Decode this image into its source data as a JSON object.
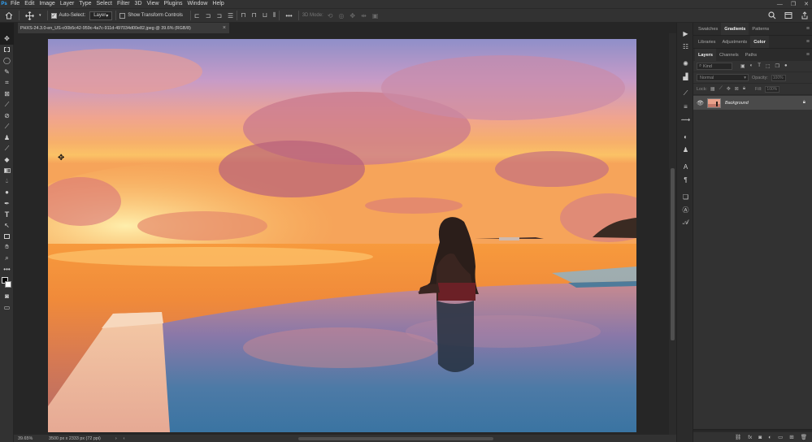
{
  "app": {
    "logo": "Ps",
    "menu": [
      "File",
      "Edit",
      "Image",
      "Layer",
      "Type",
      "Select",
      "Filter",
      "3D",
      "View",
      "Plugins",
      "Window",
      "Help"
    ],
    "window_controls": [
      "—",
      "❐",
      "✕"
    ]
  },
  "options_bar": {
    "auto_select_label": "Auto-Select:",
    "auto_select_checked": true,
    "target_value": "Layer",
    "show_transform_label": "Show Transform Controls",
    "more_label": "•••",
    "mode_3d_label": "3D Mode:"
  },
  "document": {
    "tab_title": "PHXS-24.3.0-en_US-c00b5c42-959c-4a7c-911d-497034d00e82.jpeg @ 39.6% (RGB/8)",
    "tab_close": "×"
  },
  "status": {
    "zoom": "39.65%",
    "dimensions": "3500 px x 2333 px (72 ppi)",
    "arrow": "›",
    "left_arrow": "‹"
  },
  "panels": {
    "top_tabs": [
      "Swatches",
      "Gradients",
      "Patterns"
    ],
    "top_active": 1,
    "mid_tabs": [
      "Libraries",
      "Adjustments",
      "Color"
    ],
    "mid_active": 2,
    "layer_tabs": [
      "Layers",
      "Channels",
      "Paths"
    ],
    "layer_active": 0,
    "kind_placeholder": "Kind",
    "blend_mode": "Normal",
    "opacity_label": "Opacity:",
    "opacity_value": "100%",
    "lock_label": "Lock:",
    "fill_label": "Fill:",
    "fill_value": "100%",
    "panel_menu": "≡"
  },
  "layers": [
    {
      "name": "Background",
      "visible": true,
      "locked": true
    }
  ],
  "colors": {
    "accent": "#31a8ff",
    "bg": "#1e1e1e",
    "panel": "#323232"
  }
}
